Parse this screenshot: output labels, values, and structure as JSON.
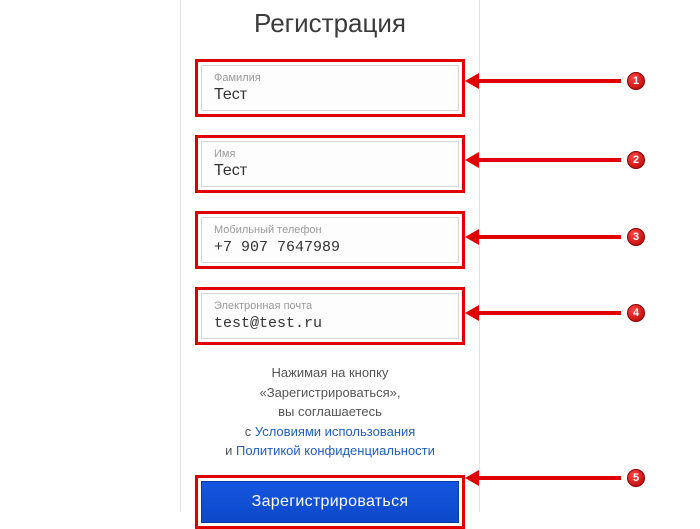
{
  "title": "Регистрация",
  "fields": {
    "lastname": {
      "label": "Фамилия",
      "value": "Тест"
    },
    "firstname": {
      "label": "Имя",
      "value": "Тест"
    },
    "phone": {
      "label": "Мобильный телефон",
      "value": "+7 907 7647989"
    },
    "email": {
      "label": "Электронная почта",
      "value": "test@test.ru"
    }
  },
  "agreement": {
    "line1": "Нажимая на кнопку",
    "line2": "«Зарегистрироваться»,",
    "line3": "вы соглашаетесь",
    "line4_prefix": "с ",
    "terms_link": "Условиями использования",
    "line5_prefix": "и ",
    "privacy_link": "Политикой конфиденциальности"
  },
  "button": "Зарегистрироваться",
  "callouts": {
    "c1": "1",
    "c2": "2",
    "c3": "3",
    "c4": "4",
    "c5": "5"
  }
}
